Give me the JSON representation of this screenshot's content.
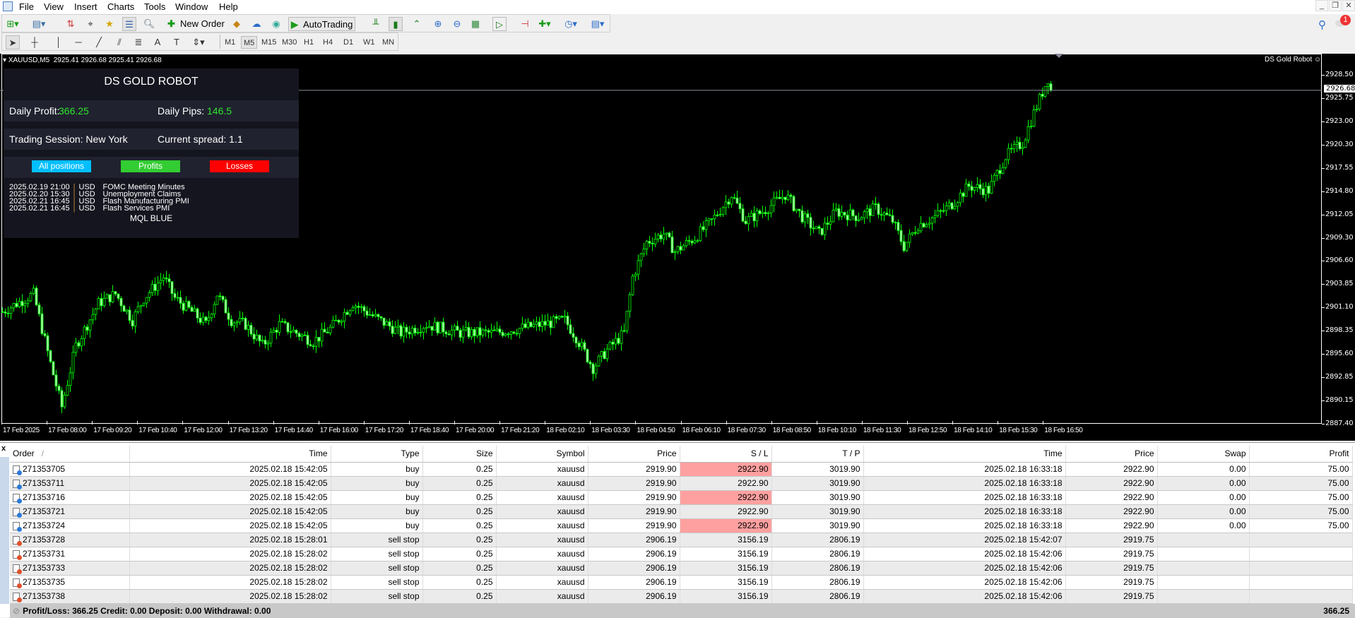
{
  "menu": [
    "File",
    "View",
    "Insert",
    "Charts",
    "Tools",
    "Window",
    "Help"
  ],
  "window_controls": {
    "minimize": "_",
    "restore": "❐",
    "close": "✕"
  },
  "toolbar": {
    "new_order": "New Order",
    "autotrading": "AutoTrading",
    "notification_count": "1"
  },
  "timeframes": [
    "M1",
    "M5",
    "M15",
    "M30",
    "H1",
    "H4",
    "D1",
    "W1",
    "MN"
  ],
  "selected_timeframe": "M5",
  "chart_header": {
    "symbol": "XAUUSD,M5",
    "ohlc": "2925.41 2926.68 2925.41 2926.68",
    "ea_label": "DS Gold Robot"
  },
  "panel": {
    "title": "DS GOLD ROBOT",
    "daily_profit_label": "Daily Profit:",
    "daily_profit": "366.25",
    "daily_pips_label": "Daily Pips:",
    "daily_pips": "146.5",
    "session_label": "Trading Session: New York",
    "spread_label": "Current spread: 1.1",
    "buttons": {
      "all": "All positions",
      "profits": "Profits",
      "losses": "Losses"
    },
    "news": [
      {
        "time": "2025.02.19 21:00",
        "cur": "USD",
        "event": "FOMC Meeting Minutes"
      },
      {
        "time": "2025.02.20 15:30",
        "cur": "USD",
        "event": "Unemployment Claims"
      },
      {
        "time": "2025.02.21 16:45",
        "cur": "USD",
        "event": "Flash Manufacturing PMI"
      },
      {
        "time": "2025.02.21 16:45",
        "cur": "USD",
        "event": "Flash Services PMI"
      }
    ],
    "footer": "MQL BLUE"
  },
  "colors": {
    "candle": "#00ff00",
    "all_btn": "#00bfff",
    "profit_btn": "#32cd32",
    "loss_btn": "#ff0000",
    "sl_highlight": "#ffa0a0"
  },
  "chart_data": {
    "type": "candlestick",
    "current_price": "2926.68",
    "y_ticks": [
      "2928.50",
      "2925.75",
      "2923.00",
      "2920.30",
      "2917.55",
      "2914.80",
      "2912.05",
      "2909.30",
      "2906.60",
      "2903.85",
      "2901.10",
      "2898.35",
      "2895.60",
      "2892.85",
      "2890.15",
      "2887.40"
    ],
    "ylim": [
      2887.4,
      2928.5
    ],
    "x_ticks": [
      "17 Feb 2025",
      "17 Feb 08:00",
      "17 Feb 09:20",
      "17 Feb 10:40",
      "17 Feb 12:00",
      "17 Feb 13:20",
      "17 Feb 14:40",
      "17 Feb 16:00",
      "17 Feb 17:20",
      "17 Feb 18:40",
      "17 Feb 20:00",
      "17 Feb 21:20",
      "18 Feb 02:10",
      "18 Feb 03:30",
      "18 Feb 04:50",
      "18 Feb 06:10",
      "18 Feb 07:30",
      "18 Feb 08:50",
      "18 Feb 10:10",
      "18 Feb 11:30",
      "18 Feb 12:50",
      "18 Feb 14:10",
      "18 Feb 15:30",
      "18 Feb 16:50"
    ],
    "approx_close_by_bar": [
      [
        0,
        2900.6
      ],
      [
        11,
        2902.7
      ],
      [
        17,
        2894.5
      ],
      [
        21,
        2889.4
      ],
      [
        26,
        2896.6
      ],
      [
        34,
        2901.6
      ],
      [
        40,
        2902.7
      ],
      [
        46,
        2899.6
      ],
      [
        50,
        2902.2
      ],
      [
        57,
        2904.7
      ],
      [
        61,
        2902.2
      ],
      [
        67,
        2900.6
      ],
      [
        72,
        2899.1
      ],
      [
        76,
        2902.7
      ],
      [
        81,
        2899.6
      ],
      [
        86,
        2899.1
      ],
      [
        92,
        2896.6
      ],
      [
        98,
        2899.1
      ],
      [
        104,
        2898.1
      ],
      [
        110,
        2897.1
      ],
      [
        116,
        2898.6
      ],
      [
        124,
        2901.6
      ],
      [
        131,
        2900.1
      ],
      [
        141,
        2898.1
      ],
      [
        150,
        2899.1
      ],
      [
        162,
        2898.1
      ],
      [
        174,
        2898.1
      ],
      [
        186,
        2898.8
      ],
      [
        199,
        2899.6
      ],
      [
        203,
        2897.6
      ],
      [
        209,
        2894.0
      ],
      [
        214,
        2896.1
      ],
      [
        220,
        2898.1
      ],
      [
        223,
        2904.7
      ],
      [
        228,
        2908.8
      ],
      [
        234,
        2909.8
      ],
      [
        238,
        2907.7
      ],
      [
        245,
        2909.3
      ],
      [
        251,
        2911.3
      ],
      [
        258,
        2914.4
      ],
      [
        263,
        2911.3
      ],
      [
        269,
        2912.4
      ],
      [
        277,
        2914.4
      ],
      [
        283,
        2911.8
      ],
      [
        289,
        2909.8
      ],
      [
        295,
        2912.4
      ],
      [
        303,
        2911.8
      ],
      [
        309,
        2912.8
      ],
      [
        315,
        2911.3
      ],
      [
        319,
        2908.3
      ],
      [
        324,
        2910.8
      ],
      [
        330,
        2911.8
      ],
      [
        336,
        2913.3
      ],
      [
        342,
        2915.4
      ],
      [
        349,
        2914.9
      ],
      [
        355,
        2918.9
      ],
      [
        361,
        2920.5
      ],
      [
        365,
        2924.0
      ],
      [
        370,
        2928.1
      ],
      [
        371,
        2926.68
      ]
    ]
  },
  "terminal": {
    "columns": [
      "Order",
      "Time",
      "Type",
      "Size",
      "Symbol",
      "Price",
      "S / L",
      "T / P",
      "Time",
      "Price",
      "Swap",
      "Profit"
    ],
    "rows": [
      [
        "271353705",
        "2025.02.18 15:42:05",
        "buy",
        "0.25",
        "xauusd",
        "2919.90",
        "2922.90",
        "3019.90",
        "2025.02.18 16:33:18",
        "2922.90",
        "0.00",
        "75.00"
      ],
      [
        "271353711",
        "2025.02.18 15:42:05",
        "buy",
        "0.25",
        "xauusd",
        "2919.90",
        "2922.90",
        "3019.90",
        "2025.02.18 16:33:18",
        "2922.90",
        "0.00",
        "75.00"
      ],
      [
        "271353716",
        "2025.02.18 15:42:05",
        "buy",
        "0.25",
        "xauusd",
        "2919.90",
        "2922.90",
        "3019.90",
        "2025.02.18 16:33:18",
        "2922.90",
        "0.00",
        "75.00"
      ],
      [
        "271353721",
        "2025.02.18 15:42:05",
        "buy",
        "0.25",
        "xauusd",
        "2919.90",
        "2922.90",
        "3019.90",
        "2025.02.18 16:33:18",
        "2922.90",
        "0.00",
        "75.00"
      ],
      [
        "271353724",
        "2025.02.18 15:42:05",
        "buy",
        "0.25",
        "xauusd",
        "2919.90",
        "2922.90",
        "3019.90",
        "2025.02.18 16:33:18",
        "2922.90",
        "0.00",
        "75.00"
      ],
      [
        "271353728",
        "2025.02.18 15:28:01",
        "sell stop",
        "0.25",
        "xauusd",
        "2906.19",
        "3156.19",
        "2806.19",
        "2025.02.18 15:42:07",
        "2919.75",
        "",
        ""
      ],
      [
        "271353731",
        "2025.02.18 15:28:02",
        "sell stop",
        "0.25",
        "xauusd",
        "2906.19",
        "3156.19",
        "2806.19",
        "2025.02.18 15:42:06",
        "2919.75",
        "",
        ""
      ],
      [
        "271353733",
        "2025.02.18 15:28:02",
        "sell stop",
        "0.25",
        "xauusd",
        "2906.19",
        "3156.19",
        "2806.19",
        "2025.02.18 15:42:06",
        "2919.75",
        "",
        ""
      ],
      [
        "271353735",
        "2025.02.18 15:28:02",
        "sell stop",
        "0.25",
        "xauusd",
        "2906.19",
        "3156.19",
        "2806.19",
        "2025.02.18 15:42:06",
        "2919.75",
        "",
        ""
      ],
      [
        "271353738",
        "2025.02.18 15:28:02",
        "sell stop",
        "0.25",
        "xauusd",
        "2906.19",
        "3156.19",
        "2806.19",
        "2025.02.18 15:42:06",
        "2919.75",
        "",
        ""
      ]
    ],
    "status": "Profit/Loss: 366.25  Credit: 0.00  Deposit: 0.00  Withdrawal: 0.00",
    "total": "366.25",
    "close": "x"
  }
}
